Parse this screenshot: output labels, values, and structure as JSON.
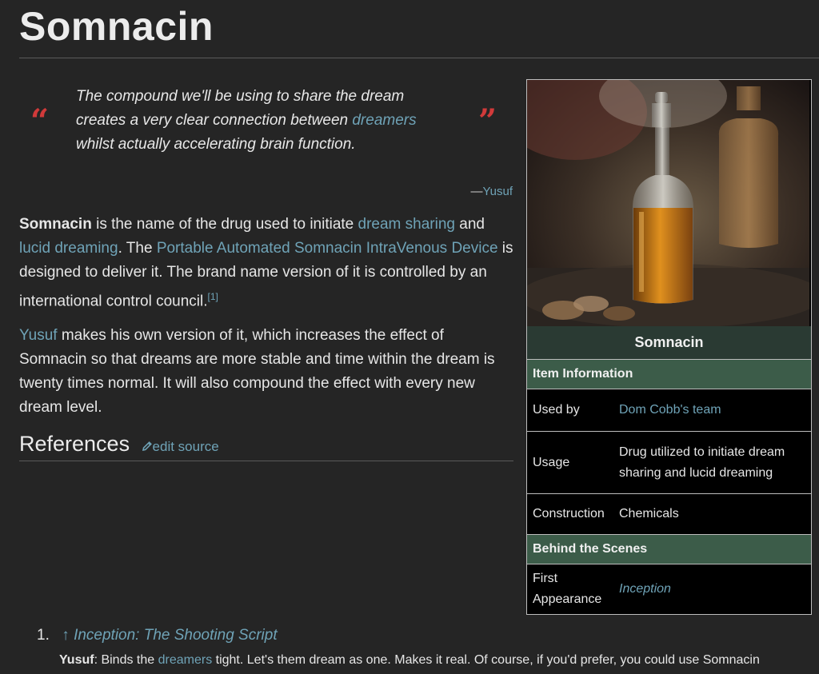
{
  "page": {
    "title": "Somnacin"
  },
  "quote": {
    "open_mark": "“",
    "close_mark": "”",
    "line1": "The compound we'll be using to share the dream",
    "line2_pre": "creates a very clear connection between ",
    "line2_link": "dreamers",
    "line3": "whilst actually accelerating brain function.",
    "dash": "—",
    "author": "Yusuf"
  },
  "paragraph1": {
    "bold": "Somnacin",
    "t1": " is the name of the drug used to initiate ",
    "link1": "dream sharing",
    "t2": " and ",
    "link2": "lucid dreaming",
    "t3": ". The ",
    "link3": "Portable Automated Somnacin IntraVenous Device",
    "t4": " is designed to deliver it. The brand name version of it is controlled by an international control council.",
    "ref": "[1]"
  },
  "paragraph2": {
    "link": "Yusuf",
    "text": " makes his own version of it, which increases the effect of Somnacin so that dreams are more stable and time within the dream is twenty times normal. It will also compound the effect with every new dream level."
  },
  "references": {
    "heading": "References",
    "edit_label": "edit source",
    "items": [
      {
        "num": "1.",
        "arrow": "↑",
        "title": "Inception: The Shooting Script",
        "speaker": "Yusuf",
        "q1": ": Binds the ",
        "q_link": "dreamers",
        "q2": " tight. Let's them dream as one. Makes it real. Of course, if you'd prefer, you could use Somnacin"
      }
    ]
  },
  "infobox": {
    "title": "Somnacin",
    "section1": "Item Information",
    "rows1": [
      {
        "label": "Used by",
        "value": "Dom Cobb's team"
      },
      {
        "label": "Usage",
        "value": "Drug utilized to initiate dream sharing and lucid dreaming"
      },
      {
        "label": "Construction",
        "value": "Chemicals"
      }
    ],
    "section2": "Behind the Scenes",
    "rows2": [
      {
        "label": "First Appearance",
        "value": "Inception"
      }
    ]
  },
  "colors": {
    "background": "#252525",
    "link": "#6fa3b7",
    "quote_mark": "#d13a3a",
    "infobox_title_bg": "#2a3a33",
    "infobox_section_bg": "#3c5c49"
  }
}
